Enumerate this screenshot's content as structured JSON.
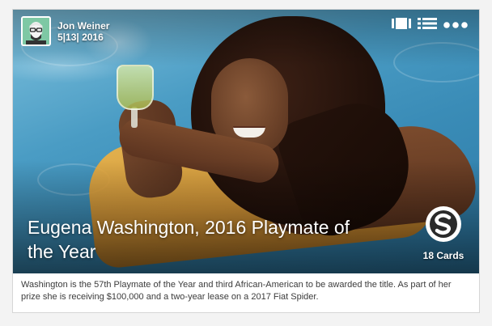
{
  "author": {
    "name": "Jon Weiner",
    "date": "5|13| 2016"
  },
  "toolbar": {
    "icons": [
      "card-view-icon",
      "list-view-icon",
      "more-icon"
    ]
  },
  "post": {
    "title": "Eugena Washington, 2016 Playmate of the Year",
    "cards_count": "18 Cards",
    "caption": "Washington is the 57th Playmate of the Year and third African-American to be awarded the title. As part of her prize she is receiving $100,000 and a two-year lease on a 2017 Fiat Spider."
  },
  "colors": {
    "avatar_bg": "#7ec8a4",
    "page_bg": "#f3f3f3"
  }
}
